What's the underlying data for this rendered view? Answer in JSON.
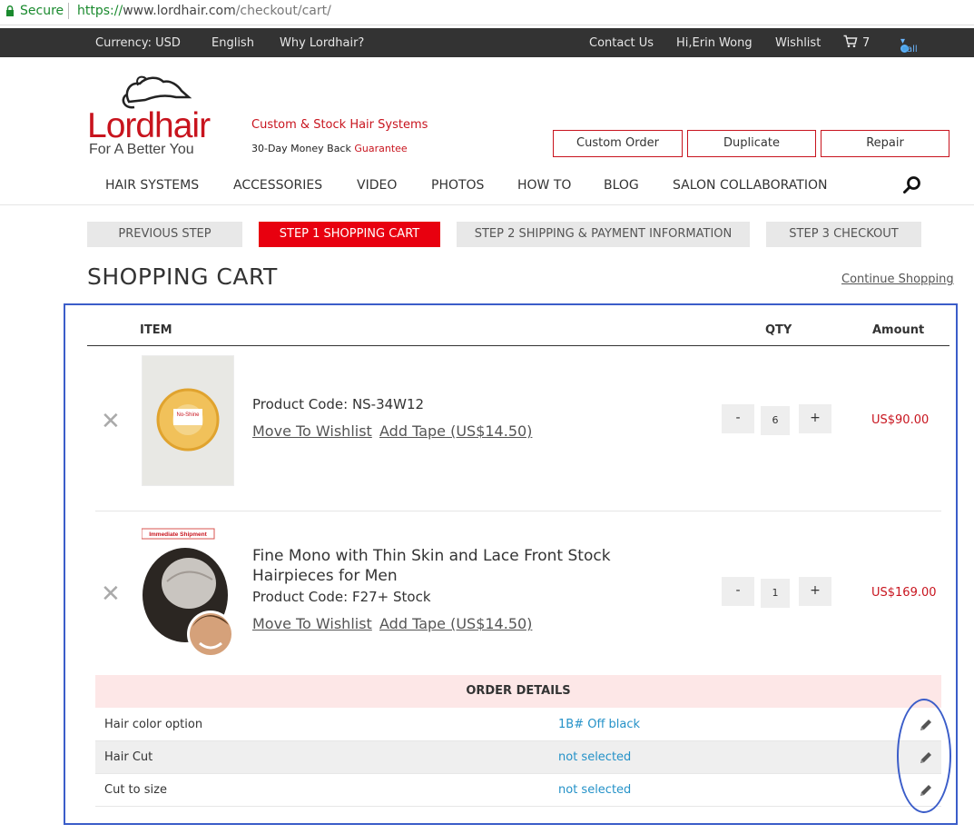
{
  "browser": {
    "secure_label": "Secure",
    "url_scheme": "https://",
    "url_host": "www.lordhair.com",
    "url_path": "/checkout/cart/"
  },
  "topbar": {
    "currency": "Currency: USD",
    "language": "English",
    "why": "Why Lordhair?",
    "contact": "Contact Us",
    "greeting": "Hi,Erin Wong",
    "wishlist": "Wishlist",
    "cart_count": "7",
    "call": "Call"
  },
  "header": {
    "logo_word": "Lordhair",
    "logo_tagline": "For A Better You",
    "tagline1": "Custom & Stock Hair Systems",
    "tagline2_prefix": "30-Day Money Back",
    "tagline2_highlight": "Guarantee",
    "buttons": [
      "Custom Order",
      "Duplicate",
      "Repair"
    ]
  },
  "nav": [
    "HAIR SYSTEMS",
    "ACCESSORIES",
    "VIDEO",
    "PHOTOS",
    "HOW TO",
    "BLOG",
    "SALON COLLABORATION"
  ],
  "steps": [
    "PREVIOUS STEP",
    "STEP 1 SHOPPING CART",
    "STEP 2 SHIPPING & PAYMENT INFORMATION",
    "STEP 3 CHECKOUT"
  ],
  "page": {
    "title": "SHOPPING CART",
    "continue": "Continue Shopping"
  },
  "table": {
    "col_item": "ITEM",
    "col_qty": "QTY",
    "col_amount": "Amount"
  },
  "items": [
    {
      "name": "",
      "code": "Product Code: NS-34W12",
      "wishlist": "Move To Wishlist",
      "tape": "Add Tape (US$14.50)",
      "qty": "6",
      "amount": "US$90.00",
      "thumb_label": "No-Shine"
    },
    {
      "name_line1": "Fine Mono with Thin Skin and Lace Front Stock",
      "name_line2": "Hairpieces for Men",
      "code": "Product Code: F27+ Stock",
      "wishlist": "Move To Wishlist",
      "tape": "Add Tape (US$14.50)",
      "qty": "1",
      "amount": "US$169.00",
      "badge": "Immediate Shipment"
    }
  ],
  "order_details": {
    "heading": "ORDER DETAILS",
    "rows": [
      {
        "label": "Hair color option",
        "value": "1B# Off black"
      },
      {
        "label": "Hair Cut",
        "value": "not selected"
      },
      {
        "label": "Cut to size",
        "value": "not selected"
      }
    ]
  },
  "colors": {
    "brand_red": "#c8141e",
    "step_active": "#e8000f",
    "link_blue": "#2592c8",
    "annotation_blue": "#3b5dc9"
  },
  "icons": [
    "lock-icon",
    "cart-icon",
    "skype-icon",
    "search-icon",
    "remove-icon",
    "pencil-icon"
  ]
}
